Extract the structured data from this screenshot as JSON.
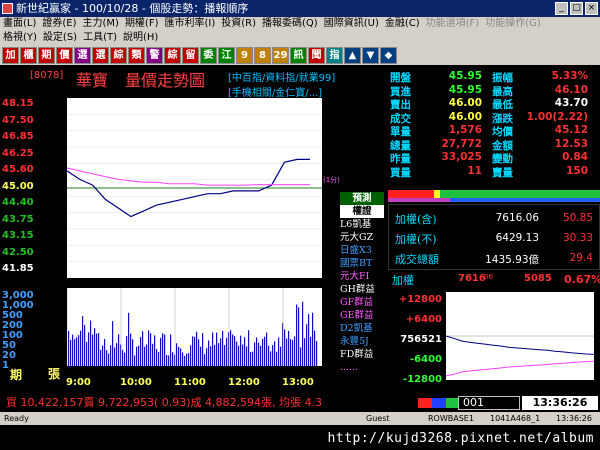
{
  "window": {
    "title": "新世紀贏家 - 100/10/28 - 個股走勢：播報順序"
  },
  "menu1": [
    "畫面(L)",
    "證券(E)",
    "主力(M)",
    "期權(F)",
    "匯市利率(I)",
    "投資(R)",
    "播報委碼(Q)",
    "國際資訊(U)",
    "金融(C)",
    "功能選項(F)",
    "功能操作(G)"
  ],
  "menu2": [
    "格視(Y)",
    "設定(S)",
    "工具(T)",
    "說明(H)"
  ],
  "toolbar": [
    "加",
    "櫃",
    "期",
    "價",
    "選",
    "選",
    "綜",
    "類",
    "警",
    "綜",
    "留",
    "委",
    "江",
    "9",
    "8",
    "29",
    "訊",
    "聞",
    "指",
    "▲",
    "▼",
    "◆"
  ],
  "header": {
    "code": "[8078]",
    "name": "華寶",
    "title": "量價走勢圖",
    "cats": [
      "[中百指/資料指/就業99]",
      "[手機相關/金仁寶/...]"
    ]
  },
  "price_axis": [
    "48.15",
    "47.50",
    "46.85",
    "46.25",
    "45.60",
    "45.00",
    "44.40",
    "43.75",
    "43.15",
    "42.50",
    "41.85"
  ],
  "vol_axis": [
    "3,000",
    "1,000",
    "500",
    "200",
    "100",
    "50",
    "20",
    "1"
  ],
  "vol_label": "張",
  "period_label": "期",
  "ref_label": "(1分)",
  "indicators": [
    {
      "label": "預測",
      "color": "#ffffff"
    },
    {
      "label": "權證",
      "color": "#ffffff"
    },
    {
      "label": "L6凱基",
      "color": "#ffffff"
    },
    {
      "label": "元大GZ",
      "color": "#ffffff"
    },
    {
      "label": "日盛X3",
      "color": "#40a0ff"
    },
    {
      "label": "國票BT",
      "color": "#40a0ff"
    },
    {
      "label": "元大FI",
      "color": "#ff60ff"
    },
    {
      "label": "GH群益",
      "color": "#ffffff"
    },
    {
      "label": "GF群益",
      "color": "#ff60ff"
    },
    {
      "label": "GE群益",
      "color": "#ff60ff"
    },
    {
      "label": "D2凱基",
      "color": "#40a0ff"
    },
    {
      "label": "永豐5J",
      "color": "#40a0ff"
    },
    {
      "label": "FD群益",
      "color": "#ffffff"
    },
    {
      "label": "......",
      "color": "#ff60ff"
    }
  ],
  "quote": [
    [
      "開盤",
      "45.95",
      "#30ff30",
      "振幅",
      "5.33%",
      "#ff3030"
    ],
    [
      "買進",
      "45.95",
      "#30ff30",
      "最高",
      "46.10",
      "#ff3030"
    ],
    [
      "賣出",
      "46.00",
      "#ffff40",
      "最低",
      "43.70",
      "#ffffff"
    ],
    [
      "成交",
      "46.00",
      "#ffff40",
      "漲跌",
      "1.00(2.22)",
      "#ff3030"
    ],
    [
      "單量",
      "1,576",
      "#ff3030",
      "均價",
      "45.12",
      "#ff3030"
    ],
    [
      "總量",
      "27,772",
      "#ff3030",
      "金額",
      "12.53",
      "#ff3030"
    ],
    [
      "昨量",
      "33,025",
      "#ff3030",
      "變動",
      "0.84",
      "#ff3030"
    ],
    [
      "買量",
      "11",
      "#ff3030",
      "賣量",
      "150",
      "#ff3030"
    ]
  ],
  "index": [
    [
      "加權(含)",
      "7616.06",
      "50.85"
    ],
    [
      "加權(不)",
      "6429.13",
      "30.33"
    ],
    [
      "成交總額",
      "1435.93億",
      "29.4"
    ]
  ],
  "mini": {
    "label": "加權",
    "val1": "7616",
    "val1b": "06",
    "val2": "5085",
    "pct": "0.67%",
    "axis": [
      "+12800",
      "+6400",
      "756521",
      "-6400",
      "-12800"
    ]
  },
  "xaxis": [
    "9:00",
    "10:00",
    "11:00",
    "12:00",
    "13:00"
  ],
  "bottom": {
    "summary": "買 10,422,157賣 9,722,953( 0.93)成 4,882,594張, 均張 4.3",
    "code": "001",
    "clock": "13:36:26"
  },
  "statusbar": [
    "Ready",
    "Guest",
    "ROWBASE1",
    "1041A468_1",
    "13:36:26"
  ],
  "watermark": "http://kujd3268.pixnet.net/album",
  "chart_data": [
    {
      "type": "line",
      "ylim": [
        41.85,
        48.15
      ],
      "x": [
        "9:00",
        "9:15",
        "9:30",
        "9:45",
        "10:00",
        "10:15",
        "10:30",
        "10:45",
        "11:00",
        "11:15",
        "11:30",
        "11:45",
        "12:00",
        "12:15",
        "12:30",
        "12:45",
        "13:00",
        "13:10",
        "13:20",
        "13:30"
      ],
      "series": [
        {
          "values": [
            45.6,
            45.3,
            45.1,
            44.6,
            44.3,
            44.0,
            44.2,
            44.4,
            44.5,
            44.6,
            44.7,
            44.8,
            44.8,
            44.9,
            44.9,
            44.9,
            45.1,
            45.9,
            46.0,
            46.0
          ]
        },
        {
          "values": [
            45.7,
            45.6,
            45.5,
            45.4,
            45.3,
            45.25,
            45.2,
            45.2,
            45.15,
            45.15,
            45.15,
            45.1,
            45.1,
            45.1,
            45.1,
            45.12,
            45.12,
            45.12,
            45.12,
            45.12
          ]
        }
      ]
    },
    {
      "type": "bar",
      "x": [
        "9:00",
        "10:00",
        "11:00",
        "12:00",
        "13:00"
      ],
      "values": [
        500,
        100,
        100,
        100,
        600
      ]
    },
    {
      "type": "line",
      "ylim": [
        -12800,
        12800
      ],
      "values": [
        3200,
        2500,
        1600,
        1200,
        900,
        600,
        300,
        0,
        -400,
        -600,
        -800,
        -1000,
        -1200,
        -1400,
        -1700,
        -1900,
        -2200,
        -2400,
        -2600,
        -2700
      ]
    }
  ]
}
